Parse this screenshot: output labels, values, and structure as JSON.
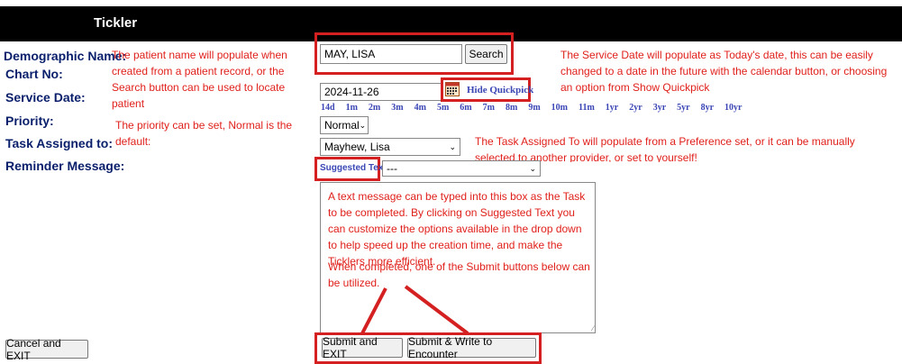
{
  "window": {
    "title": "Tickler"
  },
  "labels": {
    "demographic_name": "Demographic Name:",
    "chart_no": "Chart No:",
    "service_date": "Service Date:",
    "priority": "Priority:",
    "task_assigned_to": "Task Assigned to:",
    "reminder_message": "Reminder Message:"
  },
  "demographic": {
    "name_value": "MAY, LISA",
    "search_label": "Search"
  },
  "service_date": {
    "value": "2024-11-26",
    "hide_quickpick_label": "Hide Quickpick",
    "quickpick": [
      "14d",
      "1m",
      "2m",
      "3m",
      "4m",
      "5m",
      "6m",
      "7m",
      "8m",
      "9m",
      "10m",
      "11m",
      "1yr",
      "2yr",
      "3yr",
      "5yr",
      "8yr",
      "10yr"
    ]
  },
  "priority": {
    "selected": "Normal"
  },
  "assigned": {
    "selected": "Mayhew, Lisa"
  },
  "reminder": {
    "suggested_text_label": "Suggested Text:",
    "suggested_selected": "---"
  },
  "buttons": {
    "cancel_exit": "Cancel and EXIT",
    "submit_exit": "Submit and EXIT",
    "submit_write": "Submit & Write to Encounter"
  },
  "annotations": {
    "patient_name": "The patient name will populate when created from a patient record, or the Search button can be used to locate patient",
    "service_date": "The Service Date will populate as Today's date, this can be easily changed to a date in the future with the calendar button, or choosing an option from Show Quickpick",
    "priority": "The priority can be set, Normal is the default:",
    "task_assigned": "The Task Assigned To will populate from a Preference set, or it can be manually selected to another provider, or set to yourself!",
    "message_box": "A text message can be typed into this box as the Task to be completed.  By clicking on Suggested Text you can customize the options available in the drop down to help speed up the creation time, and make the Ticklers more efficient.",
    "submit_note": "When completed, one of the Submit buttons below can be utilized."
  },
  "colors": {
    "label": "#0a1f6b",
    "annotation": "#e0201b",
    "highlight_box": "#d42020",
    "title_bar": "#000000"
  }
}
